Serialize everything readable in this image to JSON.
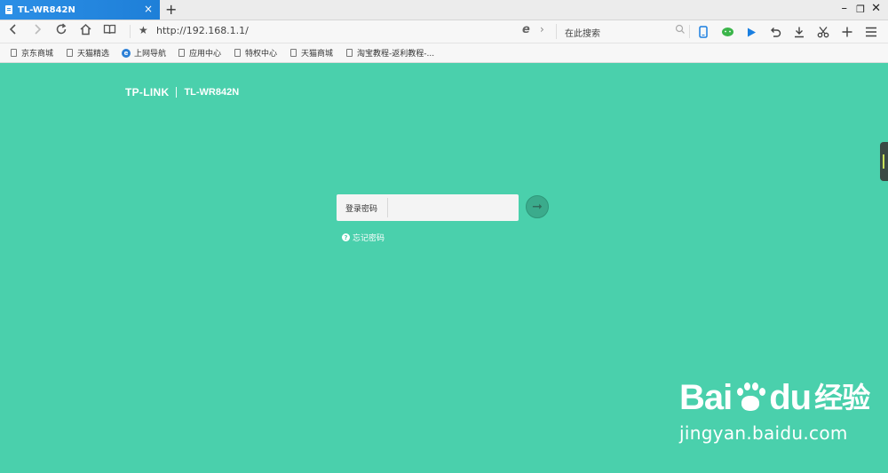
{
  "browser": {
    "tab_title": "TL-WR842N",
    "new_tab": "+",
    "tab_close": "×",
    "url": "http://192.168.1.1/",
    "search_placeholder": "在此搜索",
    "window_controls": {
      "minimize": "–",
      "restore": "❐",
      "close": "✕"
    },
    "accent_color": "#2c8fe6",
    "toolbar_icons": [
      "back-icon",
      "forward-icon",
      "refresh-icon",
      "home-icon",
      "reading-mode-icon",
      "star-icon",
      "ie-engine-icon",
      "search-icon",
      "mobile-icon",
      "wechat-icon",
      "play-icon",
      "undo-icon",
      "download-icon",
      "scissors-icon",
      "plus-icon",
      "menu-icon"
    ]
  },
  "bookmarks": [
    {
      "label": "京东商城",
      "icon": "page-icon"
    },
    {
      "label": "天猫精选",
      "icon": "page-icon"
    },
    {
      "label": "上网导航",
      "icon": "ie-icon"
    },
    {
      "label": "应用中心",
      "icon": "page-icon"
    },
    {
      "label": "特权中心",
      "icon": "page-icon"
    },
    {
      "label": "天猫商城",
      "icon": "page-icon"
    },
    {
      "label": "淘宝教程-返利教程-...",
      "icon": "page-icon"
    }
  ],
  "page": {
    "background_color": "#4ad0ac",
    "brand_logo": "TP-LINK",
    "model": "TL-WR842N",
    "login_label": "登录密码",
    "password_value": "",
    "submit_arrow": "➞",
    "forgot_password": "忘记密码",
    "forgot_icon": "?"
  },
  "watermark": {
    "brand_left": "Bai",
    "brand_mid": "du",
    "brand_right": "经验",
    "url": "jingyan.baidu.com"
  }
}
